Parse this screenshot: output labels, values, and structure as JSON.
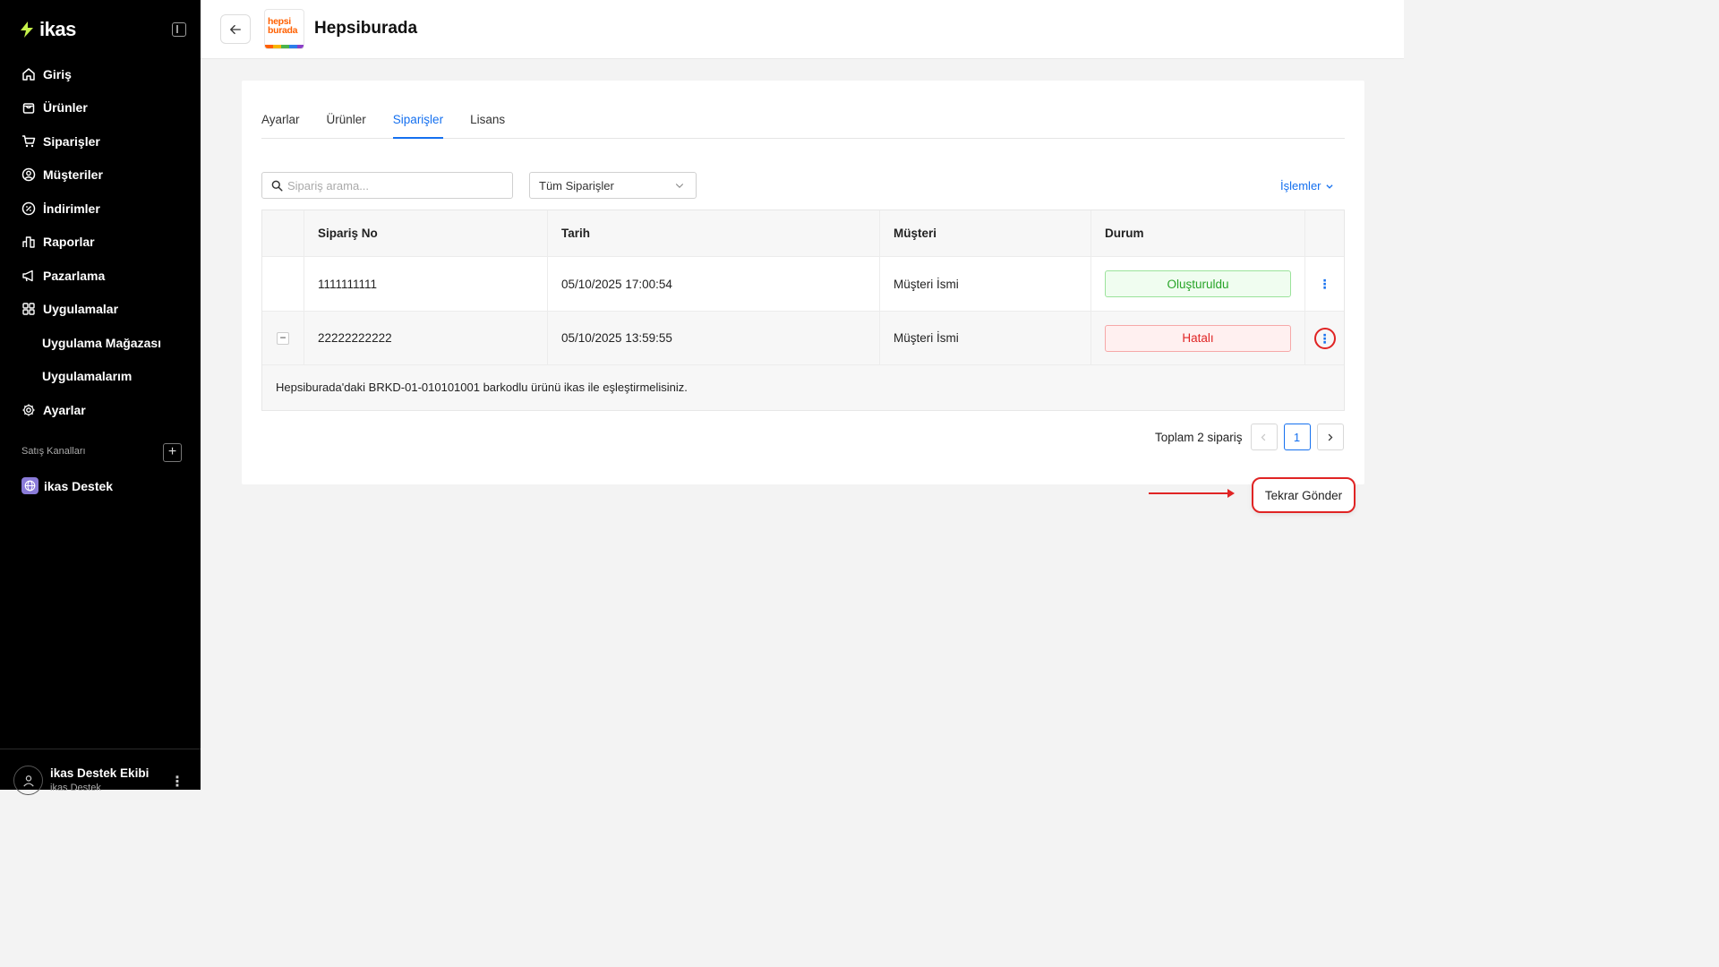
{
  "sidebar": {
    "logo_text": "ikas",
    "items": [
      {
        "label": "Giriş",
        "icon": "home-icon"
      },
      {
        "label": "Ürünler",
        "icon": "bag-icon"
      },
      {
        "label": "Siparişler",
        "icon": "cart-icon"
      },
      {
        "label": "Müşteriler",
        "icon": "user-circle-icon"
      },
      {
        "label": "İndirimler",
        "icon": "discount-icon"
      },
      {
        "label": "Raporlar",
        "icon": "chart-icon"
      },
      {
        "label": "Pazarlama",
        "icon": "megaphone-icon"
      },
      {
        "label": "Uygulamalar",
        "icon": "grid-icon"
      },
      {
        "label": "Uygulama Mağazası"
      },
      {
        "label": "Uygulamalarım"
      },
      {
        "label": "Ayarlar",
        "icon": "gear-icon"
      }
    ],
    "section_label": "Satış Kanalları",
    "channel_label": "ikas Destek",
    "user_name": "ikas Destek Ekibi",
    "user_sub": "ikas Destek"
  },
  "header": {
    "brand_logo_line1": "hepsi",
    "brand_logo_line2": "burada",
    "title": "Hepsiburada"
  },
  "tabs": [
    {
      "label": "Ayarlar"
    },
    {
      "label": "Ürünler"
    },
    {
      "label": "Siparişler",
      "active": true
    },
    {
      "label": "Lisans"
    }
  ],
  "toolbar": {
    "search_placeholder": "Sipariş arama...",
    "filter_value": "Tüm Siparişler",
    "actions_label": "İşlemler"
  },
  "table": {
    "columns": [
      "Sipariş No",
      "Tarih",
      "Müşteri",
      "Durum"
    ],
    "rows": [
      {
        "order_no": "1111111111",
        "date": "05/10/2025 17:00:54",
        "customer": "Müşteri İsmi",
        "status": "Oluşturuldu"
      },
      {
        "order_no": "22222222222",
        "date": "05/10/2025 13:59:55",
        "customer": "Müşteri İsmi",
        "status": "Hatalı"
      }
    ],
    "error_message": "Hepsiburada'daki BRKD-01-010101001 barkodlu ürünü ikas ile eşleştirmelisiniz."
  },
  "popup": {
    "label": "Tekrar Gönder"
  },
  "pagination": {
    "total_text": "Toplam 2 sipariş",
    "current_page": "1"
  },
  "colors": {
    "accent": "#1570ef",
    "success": "#28a428",
    "error": "#e02424",
    "sidebar_bg": "#000000",
    "logo_accent": "#c6f24a",
    "brand_orange": "#ff6000"
  }
}
